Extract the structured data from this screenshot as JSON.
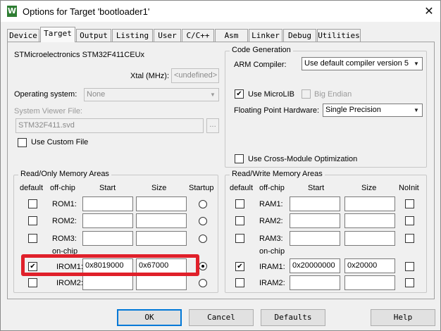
{
  "window": {
    "title": "Options for Target 'bootloader1'",
    "close_glyph": "✕",
    "icon": "keil-uvision-icon",
    "icon_glyph": "W"
  },
  "tabs": [
    "Device",
    "Target",
    "Output",
    "Listing",
    "User",
    "C/C++",
    "Asm",
    "Linker",
    "Debug",
    "Utilities"
  ],
  "active_tab": "Target",
  "target": {
    "device_name": "STMicroelectronics STM32F411CEUx",
    "xtal_label": "Xtal (MHz):",
    "xtal_value": "<undefined>",
    "os_label": "Operating system:",
    "os_value": "None",
    "svd_label": "System Viewer File:",
    "svd_value": "STM32F411.svd",
    "browse_label": "...",
    "custom_file_label": "Use Custom File"
  },
  "codegen": {
    "title": "Code Generation",
    "compiler_label": "ARM Compiler:",
    "compiler_value": "Use default compiler version 5",
    "microlib_label": "Use MicroLIB",
    "microlib_checked": true,
    "bigendian_label": "Big Endian",
    "fpu_label": "Floating Point Hardware:",
    "fpu_value": "Single Precision",
    "crossmodule_label": "Use Cross-Module Optimization"
  },
  "rom": {
    "title": "Read/Only Memory Areas",
    "headers": {
      "default": "default",
      "offchip": "off-chip",
      "start": "Start",
      "size": "Size",
      "last": "Startup"
    },
    "onchip_label": "on-chip",
    "rows": [
      {
        "label": "ROM1:",
        "default": false,
        "start": "",
        "size": "",
        "selected": false
      },
      {
        "label": "ROM2:",
        "default": false,
        "start": "",
        "size": "",
        "selected": false
      },
      {
        "label": "ROM3:",
        "default": false,
        "start": "",
        "size": "",
        "selected": false
      },
      {
        "label": "IROM1:",
        "default": true,
        "start": "0x8019000",
        "size": "0x67000",
        "selected": true
      },
      {
        "label": "IROM2:",
        "default": false,
        "start": "",
        "size": "",
        "selected": false
      }
    ]
  },
  "ram": {
    "title": "Read/Write Memory Areas",
    "headers": {
      "default": "default",
      "offchip": "off-chip",
      "start": "Start",
      "size": "Size",
      "last": "NoInit"
    },
    "onchip_label": "on-chip",
    "rows": [
      {
        "label": "RAM1:",
        "default": false,
        "start": "",
        "size": "",
        "noinit": false
      },
      {
        "label": "RAM2:",
        "default": false,
        "start": "",
        "size": "",
        "noinit": false
      },
      {
        "label": "RAM3:",
        "default": false,
        "start": "",
        "size": "",
        "noinit": false
      },
      {
        "label": "IRAM1:",
        "default": true,
        "start": "0x20000000",
        "size": "0x20000",
        "noinit": false
      },
      {
        "label": "IRAM2:",
        "default": false,
        "start": "",
        "size": "",
        "noinit": false
      }
    ]
  },
  "buttons": {
    "ok": "OK",
    "cancel": "Cancel",
    "defaults": "Defaults",
    "help": "Help"
  },
  "colors": {
    "highlight": "#e0202a",
    "accent": "#0078d7",
    "app_icon": "#2e7d32"
  }
}
